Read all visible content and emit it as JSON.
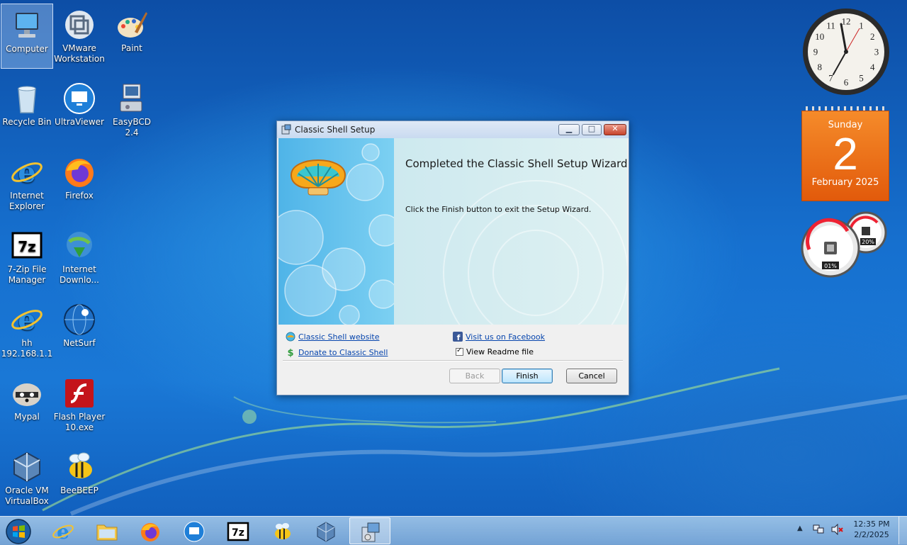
{
  "desktop": {
    "icons": [
      {
        "label": "Computer"
      },
      {
        "label": "VMware Workstation"
      },
      {
        "label": "Paint"
      },
      {
        "label": "Recycle Bin"
      },
      {
        "label": "UltraViewer"
      },
      {
        "label": "EasyBCD 2.4"
      },
      {
        "label": "Internet Explorer"
      },
      {
        "label": "Firefox"
      },
      {
        "label": "7-Zip File Manager"
      },
      {
        "label": "Internet Downlo..."
      },
      {
        "label": "hh 192.168.1.1"
      },
      {
        "label": "NetSurf"
      },
      {
        "label": "Mypal"
      },
      {
        "label": "Flash Player 10.exe"
      },
      {
        "label": "Oracle VM VirtualBox"
      },
      {
        "label": "BeeBEEP"
      }
    ]
  },
  "gadgets": {
    "clock_numerals": [
      "12",
      "1",
      "2",
      "3",
      "4",
      "5",
      "6",
      "7",
      "8",
      "9",
      "10",
      "11"
    ],
    "calendar": {
      "day_name": "Sunday",
      "day_number": "2",
      "month_year": "February 2025"
    },
    "meters": {
      "cpu": "01%",
      "memory": "20%"
    }
  },
  "dialog": {
    "title": "Classic Shell Setup",
    "heading": "Completed the Classic Shell Setup Wizard",
    "description": "Click the Finish button to exit the Setup Wizard.",
    "links": {
      "website": "Classic Shell website",
      "donate": "Donate to Classic Shell",
      "facebook": "Visit us on Facebook"
    },
    "readme_checkbox": {
      "label": "View Readme file",
      "checked": true
    },
    "buttons": {
      "back": "Back",
      "finish": "Finish",
      "cancel": "Cancel"
    }
  },
  "taskbar": {
    "items": [
      "start-orb",
      "internet-explorer",
      "windows-explorer",
      "firefox",
      "ultraviewer",
      "7-zip",
      "beebeep",
      "virtualbox",
      "classic-shell-setup"
    ],
    "time": "12:35 PM",
    "date": "2/2/2025"
  },
  "colors": {
    "desktop_blue": "#1670cf",
    "calendar_orange": "#e25a0b",
    "link_blue": "#0645ad"
  }
}
